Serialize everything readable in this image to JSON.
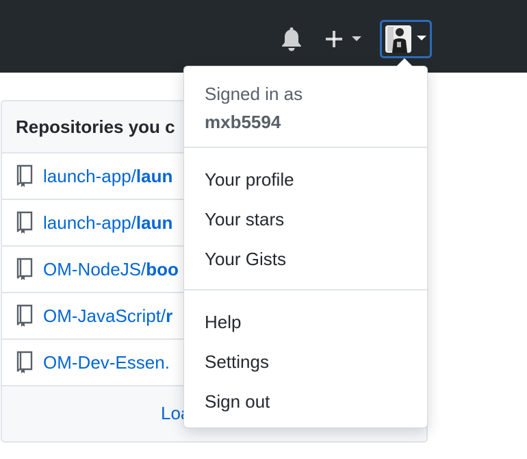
{
  "header": {
    "bell_icon": "bell-icon",
    "plus_icon": "plus-icon",
    "caret_icon": "caret-down-icon",
    "avatar_icon": "user-avatar"
  },
  "repositories": {
    "title": "Repositories you c",
    "items": [
      {
        "owner": "launch-app/",
        "name": "laun"
      },
      {
        "owner": "launch-app/",
        "name": "laun"
      },
      {
        "owner": "OM-NodeJS/",
        "name": "boo"
      },
      {
        "owner": "OM-JavaScript/",
        "name": "r"
      },
      {
        "owner": "OM-Dev-Essen.",
        "name": ""
      }
    ],
    "load_more": "Loa"
  },
  "user_menu": {
    "signed_in_label": "Signed in as",
    "username": "mxb5594",
    "items_group1": [
      "Your profile",
      "Your stars",
      "Your Gists"
    ],
    "items_group2": [
      "Help",
      "Settings",
      "Sign out"
    ]
  },
  "colors": {
    "header_bg": "#24292e",
    "link": "#0366d6",
    "focus_ring": "#2b6cb8"
  }
}
